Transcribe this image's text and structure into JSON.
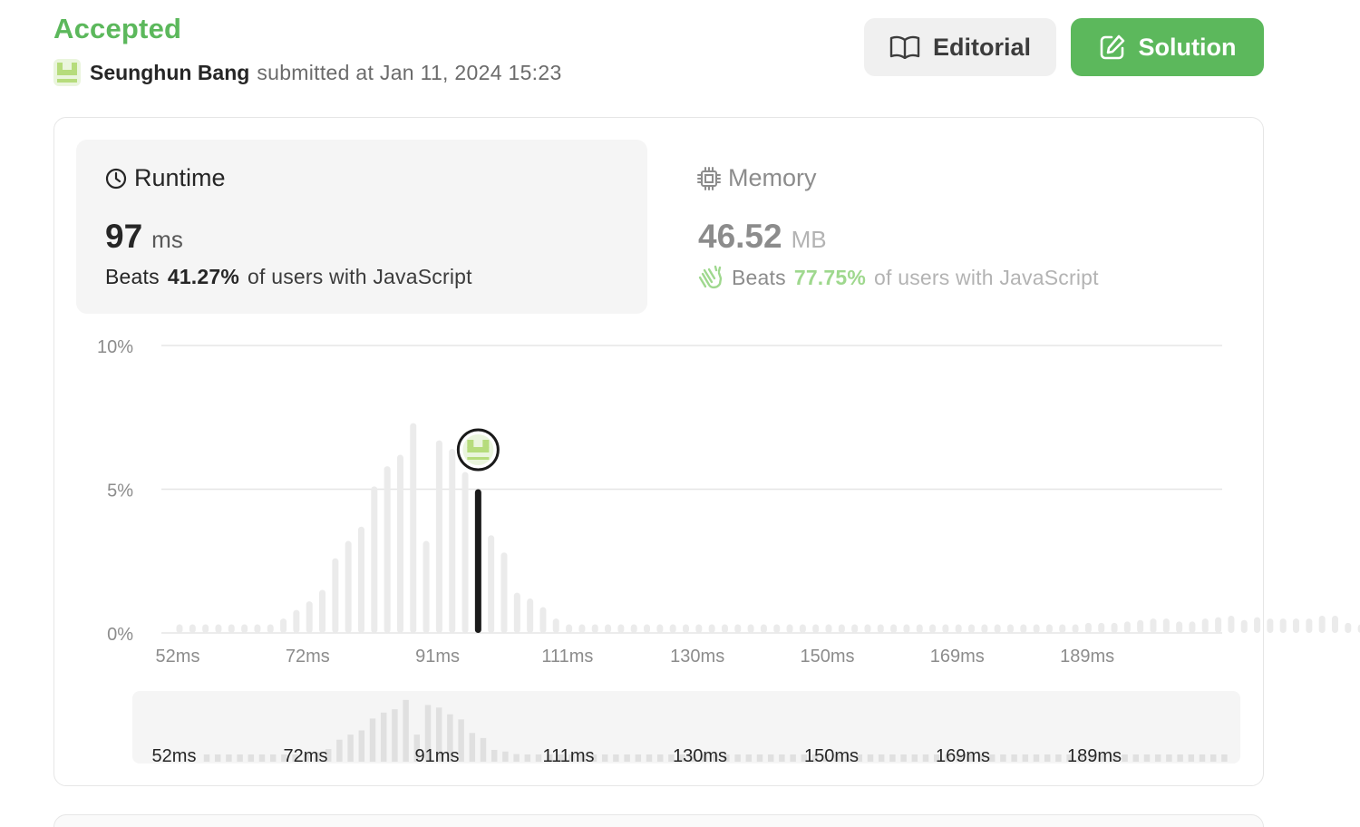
{
  "header": {
    "status": "Accepted",
    "user_name": "Seunghun Bang",
    "submitted_text": "submitted at Jan 11, 2024 15:23"
  },
  "buttons": {
    "editorial": "Editorial",
    "solution": "Solution"
  },
  "runtime": {
    "label": "Runtime",
    "value": "97",
    "unit": "ms",
    "beats_prefix": "Beats",
    "beats_pct": "41.27%",
    "beats_suffix": "of users with JavaScript"
  },
  "memory": {
    "label": "Memory",
    "value": "46.52",
    "unit": "MB",
    "beats_prefix": "Beats",
    "beats_pct": "77.75%",
    "beats_suffix": "of users with JavaScript"
  },
  "icons": {
    "editorial": "book-icon",
    "solution": "edit-icon",
    "runtime": "clock-icon",
    "memory": "chip-icon",
    "beats": "clap-icon",
    "avatar": "avatar-icon"
  },
  "colors": {
    "accepted": "#5cb85c",
    "bar": "#ebebeb",
    "highlight_bar": "#1a1a1a",
    "grid": "#e6e6e6",
    "memory_beats": "#9fd88e"
  },
  "chart_data": {
    "type": "bar",
    "y_ticks": [
      "10%",
      "5%",
      "0%"
    ],
    "ylim": [
      0,
      10
    ],
    "x_tick_labels": [
      "52ms",
      "72ms",
      "91ms",
      "111ms",
      "130ms",
      "150ms",
      "169ms",
      "189ms"
    ],
    "highlight_index": 23,
    "highlight_label": "97ms",
    "values": [
      0.3,
      0.3,
      0.3,
      0.3,
      0.3,
      0.3,
      0.3,
      0.3,
      0.5,
      0.8,
      1.1,
      1.5,
      2.6,
      3.2,
      3.7,
      5.1,
      5.8,
      6.2,
      7.3,
      3.2,
      6.7,
      6.4,
      5.6,
      5.0,
      3.4,
      2.8,
      1.4,
      1.2,
      0.9,
      0.5,
      0.3,
      0.3,
      0.3,
      0.3,
      0.3,
      0.3,
      0.3,
      0.3,
      0.3,
      0.3,
      0.3,
      0.3,
      0.3,
      0.3,
      0.3,
      0.3,
      0.3,
      0.3,
      0.3,
      0.3,
      0.3,
      0.3,
      0.3,
      0.3,
      0.3,
      0.3,
      0.3,
      0.3,
      0.3,
      0.3,
      0.3,
      0.3,
      0.3,
      0.3,
      0.3,
      0.3,
      0.3,
      0.3,
      0.3,
      0.3,
      0.35,
      0.35,
      0.35,
      0.4,
      0.45,
      0.5,
      0.5,
      0.4,
      0.4,
      0.5,
      0.55,
      0.6,
      0.45,
      0.55,
      0.5,
      0.5,
      0.5,
      0.5,
      0.6,
      0.6,
      0.35,
      0.3,
      0.3
    ],
    "grid": true
  }
}
